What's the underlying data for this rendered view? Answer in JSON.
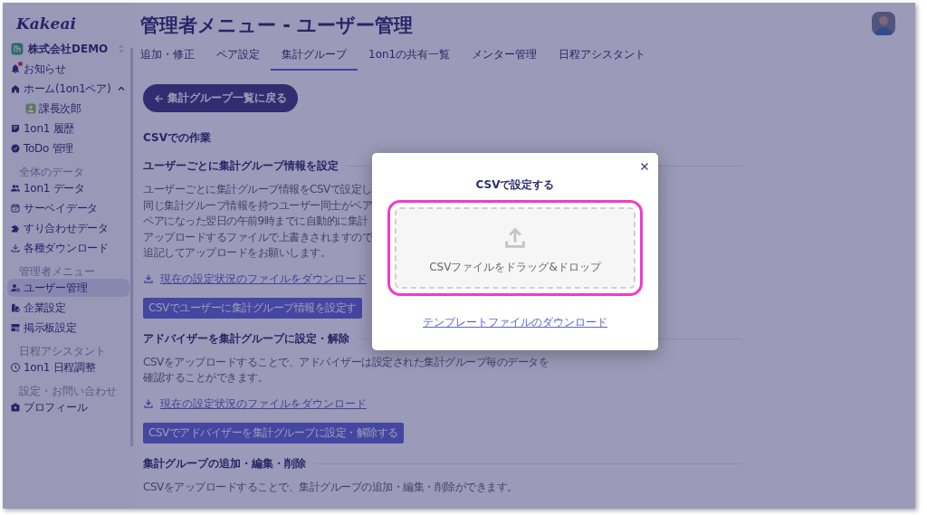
{
  "sidebar": {
    "logo": "Kakeai",
    "company": "株式会社DEMO",
    "groups": [
      {
        "items": [
          {
            "label": "お知らせ",
            "selected": false,
            "unread": true
          },
          {
            "label": "ホーム(1on1ペア)",
            "selected": false,
            "expanded": true,
            "children": [
              {
                "label": "課長次郎",
                "selected": false
              }
            ]
          },
          {
            "label": "1on1 履歴",
            "selected": false
          },
          {
            "label": "ToDo 管理",
            "selected": false
          }
        ]
      },
      {
        "title": "全体のデータ",
        "items": [
          {
            "label": "1on1 データ",
            "selected": false
          },
          {
            "label": "サーベイデータ",
            "selected": false
          },
          {
            "label": "すり合わせデータ",
            "selected": false
          },
          {
            "label": "各種ダウンロード",
            "selected": false
          }
        ]
      },
      {
        "title": "管理者メニュー",
        "items": [
          {
            "label": "ユーザー管理",
            "selected": true
          },
          {
            "label": "企業設定",
            "selected": false
          },
          {
            "label": "掲示板設定",
            "selected": false
          }
        ]
      },
      {
        "title": "日程アシスタント",
        "items": [
          {
            "label": "1on1 日程調整",
            "selected": false
          }
        ]
      },
      {
        "title": "設定・お問い合わせ",
        "items": [
          {
            "label": "プロフィール",
            "selected": false
          }
        ]
      }
    ]
  },
  "title": "管理者メニュー - ユーザー管理",
  "tabs": [
    {
      "label": "追加・修正",
      "selected": false
    },
    {
      "label": "ペア設定",
      "selected": false
    },
    {
      "label": "集計グループ",
      "selected": true
    },
    {
      "label": "1on1の共有一覧",
      "selected": false
    },
    {
      "label": "メンター管理",
      "selected": false
    },
    {
      "label": "日程アシスタント",
      "selected": false
    }
  ],
  "back_button": "集計グループ一覧に戻る",
  "content": {
    "heading": "CSVでの作業",
    "sections": [
      {
        "title": "ユーザーごとに集計グループ情報を設定",
        "paragraph_lines": [
          "ユーザーごとに集計グループ情報をCSVで設定し",
          "同じ集計グループ情報を持つユーザー同士がペア",
          "ペアになった翌日の午前9時までに自動的に集計",
          "アップロードするファイルで上書きされますので",
          "追記してアップロードをお願いします。"
        ],
        "download_link": "現在の設定状況のファイルをダウンロード",
        "action_button": "CSVでユーザーに集計グループ情報を設定す"
      },
      {
        "title": "アドバイザーを集計グループに設定・解除",
        "paragraph_lines": [
          "CSVをアップロードすることで、アドバイザーは設定された集計グループ毎のデータを",
          "確認することができます。"
        ],
        "download_link": "現在の設定状況のファイルをダウンロード",
        "action_button": "CSVでアドバイザーを集計グループに設定・解除する"
      },
      {
        "title": "集計グループの追加・編集・削除",
        "paragraph_lines": [
          "CSVをアップロードすることで、集計グループの追加・編集・削除ができます。"
        ]
      }
    ]
  },
  "modal": {
    "title": "CSVで設定する",
    "dropzone_text": "CSVファイルをドラッグ&ドロップ",
    "template_link": "テンプレートファイルのダウンロード"
  }
}
